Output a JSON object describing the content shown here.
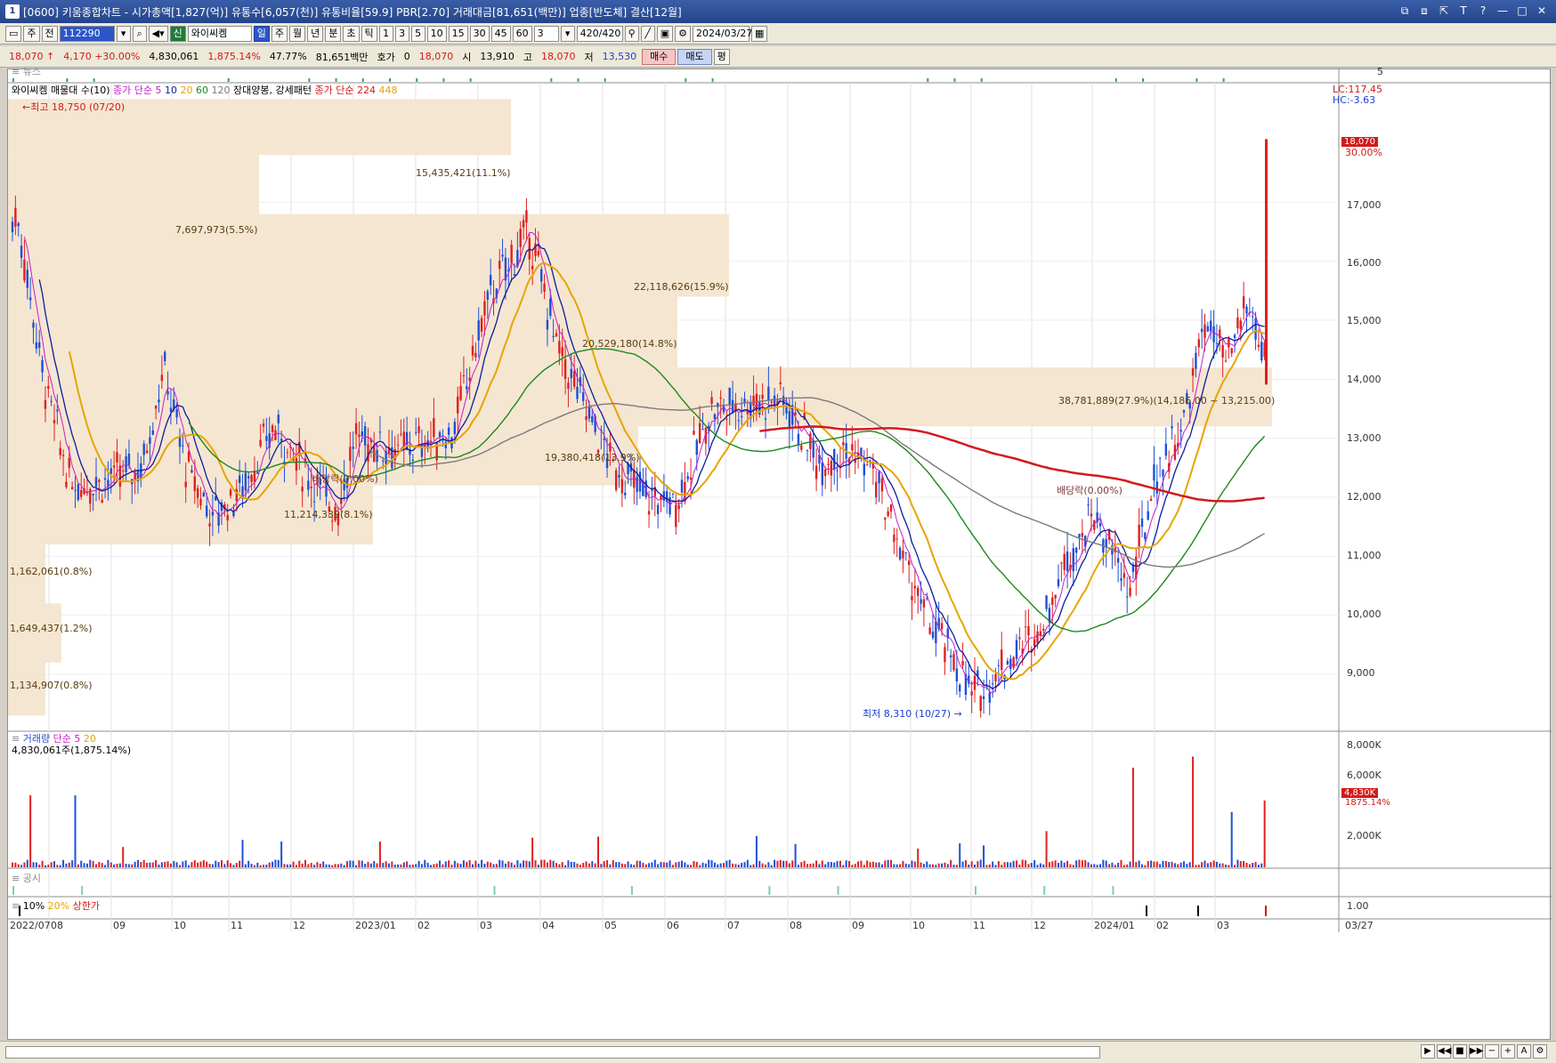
{
  "window": {
    "num": "1",
    "title": "[0600] 키움종합차트 - 시가총액[1,827(억)] 유통수[6,057(천)] 유통비율[59.9] PBR[2.70] 거래대금[81,651(백만)] 업종[반도체] 결산[12월]",
    "controls": [
      "⧉",
      "⧈",
      "⇱",
      "T",
      "?",
      "—",
      "□",
      "✕"
    ]
  },
  "toolbar1": {
    "mode": "주",
    "range": "전",
    "code": "112290",
    "market_badge": "신",
    "stock_name": "와이씨켐",
    "periods": [
      "일",
      "주",
      "월",
      "년",
      "분",
      "초",
      "틱"
    ],
    "active_period": "일",
    "minutes": [
      "1",
      "3",
      "5",
      "10",
      "15",
      "30",
      "45",
      "60"
    ],
    "count_value": "3",
    "bars": "420/420",
    "date": "2024/03/27"
  },
  "toolbar2": {
    "price": "18,070",
    "arrow": "↑",
    "change": "4,170",
    "change_pct": "+30.00%",
    "volume": "4,830,061",
    "vol_ratio": "1,875.14%",
    "turnover": "47.77%",
    "amount": "81,651백만",
    "hoga_label": "호가",
    "hoga_value": "0",
    "cur": "18,070",
    "open_label": "시",
    "open": "13,910",
    "high_label": "고",
    "high": "18,070",
    "low_label": "저",
    "low": "13,530",
    "buy": "매수",
    "sell": "매도",
    "eval": "평"
  },
  "panes": {
    "news_label": "뉴스",
    "news_axis": "5",
    "legend_main": "와이씨켐 매물대 수(10)",
    "legend_ma": "종가 단순",
    "ma_periods": [
      "5",
      "10",
      "20",
      "60",
      "120"
    ],
    "legend_pattern": "장대양봉, 강세패턴",
    "legend_ma2": "종가 단순",
    "ma2_periods": [
      "224",
      "448"
    ],
    "lc": "LC:117.45",
    "hc": "HC:-3.63",
    "high_mark": "최고 18,750 (07/20)",
    "low_mark": "최저 8,310 (10/27)",
    "exdiv1": "배당락(0.00%)",
    "exdiv2": "배당락(0.00%)",
    "cur_price_tag": "18,070",
    "cur_pct_tag": "30.00%",
    "volume_label": "거래량",
    "volume_ma": "단순",
    "volume_ma_periods": [
      "5",
      "20"
    ],
    "volume_value": "4,830,061주(1,875.14%)",
    "vol_tag": "4,830K",
    "vol_pct_tag": "1875.14%",
    "disclosure_label": "공시",
    "limit_10": "10%",
    "limit_20": "20%",
    "limit_up": "상한가",
    "limit_axis": "1.00"
  },
  "price_axis": [
    "18,000",
    "17,000",
    "16,000",
    "15,000",
    "14,000",
    "13,000",
    "12,000",
    "11,000",
    "10,000",
    "9,000"
  ],
  "volume_axis": [
    "8,000K",
    "6,000K",
    "4,000K",
    "2,000K"
  ],
  "volume_profile": [
    {
      "label": "15,435,421(11.1%)"
    },
    {
      "label": "7,697,973(5.5%)"
    },
    {
      "label": "22,118,626(15.9%)"
    },
    {
      "label": "20,529,180(14.8%)"
    },
    {
      "label": "38,781,889(27.9%)(14,186.00 ~ 13,215.00)"
    },
    {
      "label": "19,380,418(13.9%)"
    },
    {
      "label": "11,214,339(8.1%)"
    },
    {
      "label": "1,162,061(0.8%)"
    },
    {
      "label": "1,649,437(1.2%)"
    },
    {
      "label": "1,134,907(0.8%)"
    }
  ],
  "months": [
    "2022/07",
    "08",
    "09",
    "10",
    "11",
    "12",
    "2023/01",
    "02",
    "03",
    "04",
    "05",
    "06",
    "07",
    "08",
    "09",
    "10",
    "11",
    "12",
    "2024/01",
    "02",
    "03",
    "03/27"
  ],
  "colors": {
    "up": "#e02020",
    "down": "#1f4fd8",
    "ma5": "#c81ec8",
    "ma10": "#0a1e9c",
    "ma20": "#e6a500",
    "ma60": "#1a8a1a",
    "ma120": "#7a7a7a",
    "ma224": "#d21a1a",
    "profile": "#f5e6d2"
  }
}
